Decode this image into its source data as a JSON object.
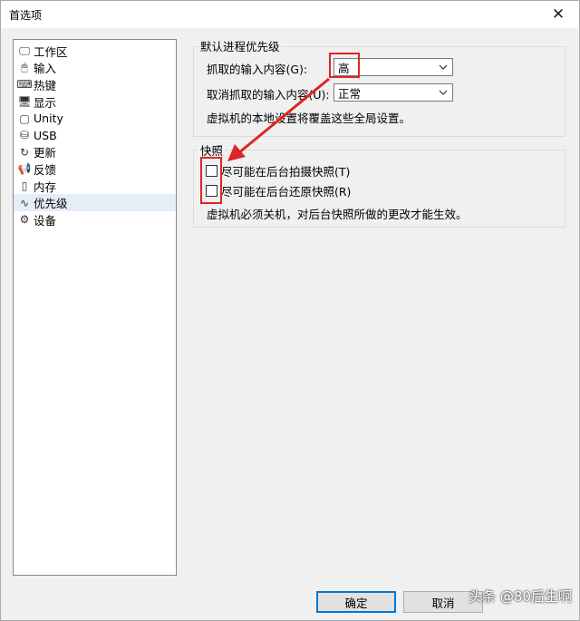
{
  "window": {
    "title": "首选项",
    "close_glyph": "✕"
  },
  "sidebar": {
    "items": [
      {
        "label": "工作区",
        "icon": "workspace-icon",
        "glyph": "🖵"
      },
      {
        "label": "输入",
        "icon": "mouse-icon",
        "glyph": "🖱"
      },
      {
        "label": "热键",
        "icon": "keyboard-icon",
        "glyph": "⌨"
      },
      {
        "label": "显示",
        "icon": "monitor-icon",
        "glyph": "🖥"
      },
      {
        "label": "Unity",
        "icon": "unity-icon",
        "glyph": "▢"
      },
      {
        "label": "USB",
        "icon": "usb-icon",
        "glyph": "⛁"
      },
      {
        "label": "更新",
        "icon": "update-icon",
        "glyph": "↻"
      },
      {
        "label": "反馈",
        "icon": "feedback-icon",
        "glyph": "📢"
      },
      {
        "label": "内存",
        "icon": "memory-icon",
        "glyph": "▯"
      },
      {
        "label": "优先级",
        "icon": "priority-icon",
        "glyph": "∿",
        "selected": true
      },
      {
        "label": "设备",
        "icon": "devices-icon",
        "glyph": "⚙"
      }
    ]
  },
  "priority": {
    "group_label": "默认进程优先级",
    "grab_label": "抓取的输入内容(G):",
    "grab_value": "高",
    "ungrab_label": "取消抓取的输入内容(U):",
    "ungrab_value": "正常",
    "note": "虚拟机的本地设置将覆盖这些全局设置。"
  },
  "snapshots": {
    "group_label": "快照",
    "take_label": "尽可能在后台拍摄快照(T)",
    "restore_label": "尽可能在后台还原快照(R)",
    "take_checked": false,
    "restore_checked": false,
    "note": "虚拟机必须关机，对后台快照所做的更改才能生效。"
  },
  "buttons": {
    "ok": "确定",
    "cancel": "取消"
  },
  "watermark": "头条 @80后生啊",
  "annotation_color": "#e02424"
}
